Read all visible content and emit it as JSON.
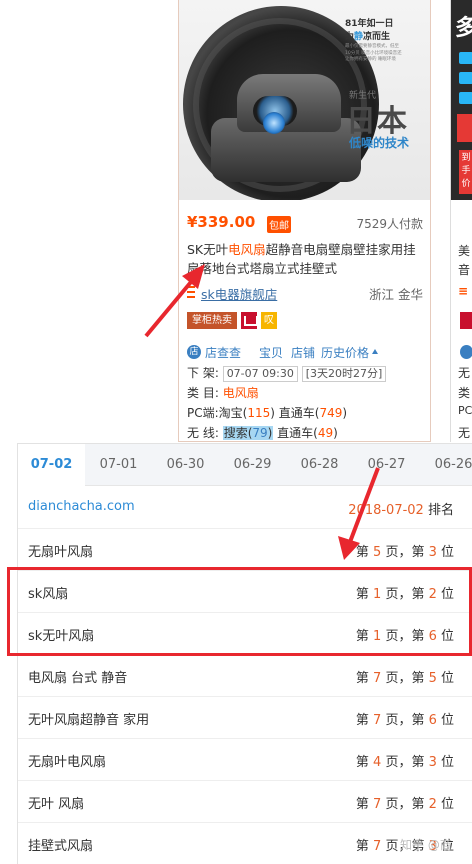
{
  "product": {
    "image_text": {
      "line1": "81年如一日",
      "line2_prefix": "为",
      "line2_highlight": "静",
      "line2_suffix": "凉而生",
      "small_text": "最小仅需要静音模式，低至10分贝 噪音小比环境噪音还 让你拥有安静的 睡眠环境",
      "new_gen": "新生代",
      "japan": "日本",
      "low_noise": "低噪的技术"
    },
    "price": "¥339.00",
    "free_shipping": "包邮",
    "pay_count": "7529人付款",
    "title_prefix": "SK无叶",
    "title_highlight": "电风扇",
    "title_suffix": "超静音电扇壁扇壁挂家用挂扇落地台式塔扇立式挂壁式",
    "shop_name": "sk电器旗舰店",
    "location": "浙江 金华",
    "badge_hot": "掌柜热卖",
    "badge_yellow": "叹",
    "link_icon": "店",
    "link_store_check": "店查查",
    "link_item": "宝贝",
    "link_shop": "店铺",
    "link_history": "历史价格",
    "offshelf_label": "下 架:",
    "offshelf_date": "07-07 09:30",
    "offshelf_remaining": "[3天20时27分]",
    "category_label": "类 目:",
    "category_value": "电风扇",
    "pc_label": "PC端:",
    "pc_taobao": "淘宝(",
    "pc_taobao_num": "115",
    "pc_close": ")",
    "pc_direct": "直通车(",
    "pc_direct_num": "749",
    "wireless_label": "无 线:",
    "wireless_search": "搜索(",
    "wireless_search_num": "79",
    "wireless_direct": "直通车(",
    "wireless_direct_num": "49"
  },
  "side_card": {
    "char1": "美",
    "char2": "音",
    "char3": "无",
    "char4": "类",
    "char5": "PC",
    "char6": "无",
    "tag_line1": "到",
    "tag_line2": "手",
    "tag_line3": "价"
  },
  "ranking": {
    "tabs": [
      "07-02",
      "07-01",
      "06-30",
      "06-29",
      "06-28",
      "06-27",
      "06-26"
    ],
    "site": "dianchacha.com",
    "site_date": "2018-07-02",
    "site_rank_label": "排名",
    "page_prefix": "第 ",
    "page_mid": " 页，第 ",
    "page_suffix": " 位",
    "rows": [
      {
        "keyword": "无扇叶风扇",
        "page": "5",
        "pos": "3"
      },
      {
        "keyword": "sk风扇",
        "page": "1",
        "pos": "2"
      },
      {
        "keyword": "sk无叶风扇",
        "page": "1",
        "pos": "6"
      },
      {
        "keyword": "电风扇 台式 静音",
        "page": "7",
        "pos": "5"
      },
      {
        "keyword": "无叶风扇超静音 家用",
        "page": "7",
        "pos": "6"
      },
      {
        "keyword": "无扇叶电风扇",
        "page": "4",
        "pos": "3"
      },
      {
        "keyword": "无叶 风扇",
        "page": "7",
        "pos": "2"
      },
      {
        "keyword": "挂壁式风扇",
        "page": "7",
        "pos": "3"
      }
    ]
  },
  "watermark": "知乎 @商",
  "colors": {
    "accent": "#ff5000",
    "link": "#2d8bd6",
    "annotation": "#e8272e"
  }
}
